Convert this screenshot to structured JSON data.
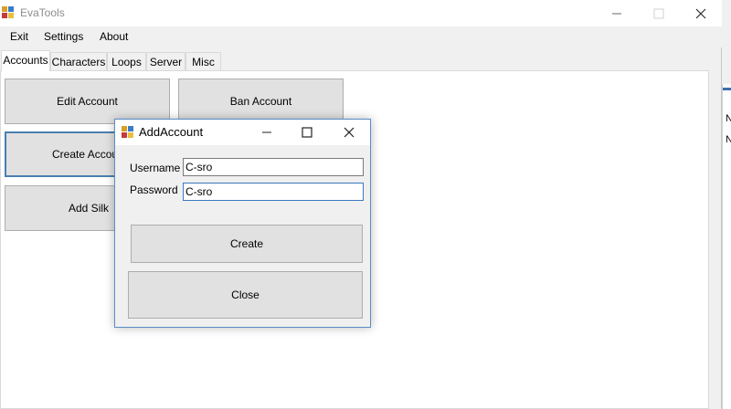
{
  "window": {
    "title": "EvaTools"
  },
  "menu": [
    "Exit",
    "Settings",
    "About"
  ],
  "tabs": [
    "Accounts",
    "Characters",
    "Loops",
    "Server",
    "Misc"
  ],
  "active_tab": "Accounts",
  "buttons": {
    "edit_account": "Edit Account",
    "ban_account": "Ban Account",
    "create_account": "Create Accoun",
    "add_silk": "Add Silk"
  },
  "dialog": {
    "title": "AddAccount",
    "username_label": "Username",
    "username_value": "C-sro",
    "password_label": "Password",
    "password_value": "C-sro",
    "create_label": "Create",
    "close_label": "Close"
  },
  "background_glyphs": [
    "N",
    "N"
  ],
  "colors": {
    "accent": "#4a7fb0",
    "dialog_border": "#5a8cc8",
    "button_face": "#e1e1e1",
    "title_text": "#8c8c8c"
  },
  "icons": [
    "app-icon",
    "minimize-icon",
    "maximize-icon",
    "close-icon"
  ]
}
